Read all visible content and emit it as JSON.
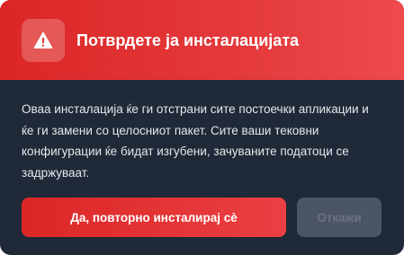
{
  "dialog": {
    "title": "Потврдете ја инсталацијата",
    "message": "Оваа инсталација ќе ги отстрани сите постоечки апликации и ќе ги замени со целосниот пакет. Сите ваши тековни конфигурации ќе бидат изгубени, зачуваните податоци се задржуваат.",
    "icon": "warning-icon",
    "confirm_label": "Да, повторно инсталирај сè",
    "cancel_label": "Откажи"
  },
  "colors": {
    "header_start": "#dc2626",
    "header_end": "#ee4a4d",
    "body_background": "#1f2937",
    "cancel_background": "#4b5563",
    "cancel_text": "#6b7280"
  }
}
